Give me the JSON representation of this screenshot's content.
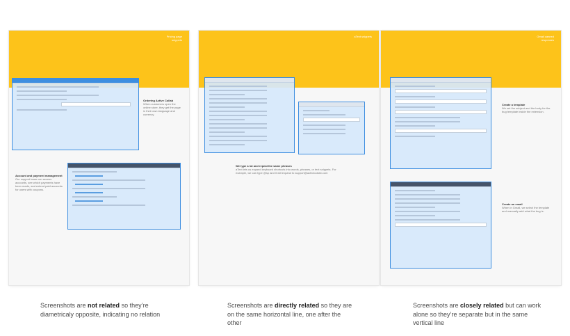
{
  "panels": [
    {
      "tag": "Pricing page snippets",
      "desc1_title": "Ordering Active Collab",
      "desc1_text": "When customers open the online store, they get the page in their own language and currency.",
      "desc2_title": "Account and payment management",
      "desc2_text": "Our support team can access accounts, see which payments have been made, and extend paid accounts for users with coupons.",
      "caption_pre": "Screenshots are ",
      "caption_bold": "not related",
      "caption_post": " so they’re diametricaly opposite, indicating no relation"
    },
    {
      "tag": "aText snippets",
      "desc_title": "We type a lot and repeat the same phrases",
      "desc_text": "aText lets us expand keyboard shortcuts into words, phrases, or text snippets. For example, we can type @sp and it will expand to support@activecollab.com",
      "caption_pre": "Screenshots are ",
      "caption_bold": "directly related",
      "caption_post": " so they are on the same horizontal line, one after the other"
    },
    {
      "tag": "Gmail canned responses",
      "desc1_title": "Create a template",
      "desc1_text": "We set the subject and the body for the bug template inside the extension.",
      "desc2_title": "Create an email",
      "desc2_text": "When in Gmail, we select the template and manually add what the bug is.",
      "caption_pre": "Screenshots are ",
      "caption_bold": "closely related",
      "caption_post": " but can work alone so they’re separate but in the same vertical line"
    }
  ],
  "colors": {
    "band": "#fdc31a",
    "highlight": "#3d8ee0"
  }
}
